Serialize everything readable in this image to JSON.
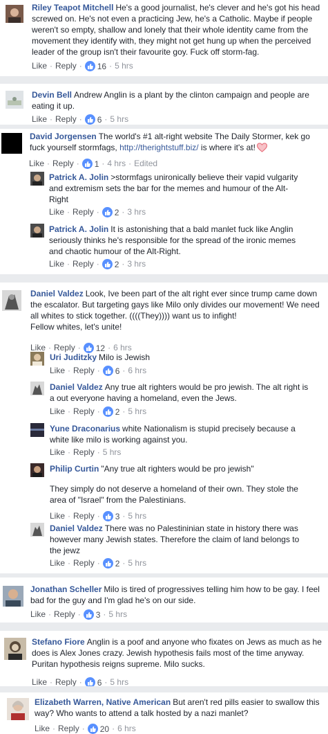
{
  "ui": {
    "like": "Like",
    "reply": "Reply",
    "edited": "Edited",
    "dot": "·"
  },
  "comments": [
    {
      "author": "Riley Teapot Mitchell",
      "text": "He's a good journalist, he's clever and he's got his head screwed on. He's not even a practicing Jew, he's a Catholic. Maybe if people weren't so empty, shallow and lonely that their whole identity came from the movement they identify with, they might not get hung up when the perceived leader of the group isn't their favourite goy. Fuck off storm-fag.",
      "likes": "16",
      "time": "5 hrs"
    },
    {
      "author": "Devin Bell",
      "text": "Andrew Anglin is a plant by the clinton campaign and people are eating it up.",
      "likes": "6",
      "time": "5 hrs"
    },
    {
      "author": "David Jorgensen",
      "text": "The world's #1 alt-right website The Daily Stormer, kek go fuck yourself stormfags,",
      "link": "http://therightstuff.biz/",
      "text_after": "is where it's at!",
      "likes": "1",
      "time": "4 hrs"
    },
    {
      "author": "Patrick A. Jolin",
      "text": ">stormfags unironically believe their vapid vulgarity and extremism sets the bar for the memes and humour of the Alt-Right",
      "likes": "2",
      "time": "3 hrs"
    },
    {
      "author": "Patrick A. Jolin",
      "text": "It is astonishing that a bald manlet fuck like Anglin seriously thinks he's responsible for the spread of the ironic memes and chaotic humour of the Alt-Right.",
      "likes": "2",
      "time": "3 hrs"
    },
    {
      "author": "Daniel Valdez",
      "text": "Look, Ive been part of the alt right ever since trump came down the escalator. But targeting gays like Milo only divides our movement! We need all whites to stick together. ((((They)))) want us to infight!",
      "text2": "Fellow whites, let's unite!",
      "likes": "12",
      "time": "6 hrs"
    },
    {
      "author": "Uri Juditzky",
      "text": "Milo is Jewish",
      "likes": "6",
      "time": "6 hrs"
    },
    {
      "author": "Daniel Valdez",
      "text": "Any true alt righters would be pro jewish. The alt right is a out everyone having a homeland, even the Jews.",
      "likes": "2",
      "time": "5 hrs"
    },
    {
      "author": "Yune Draconarius",
      "text": "white Nationalism is stupid precisely because a white like milo is working against you.",
      "time": "5 hrs"
    },
    {
      "author": "Philip Curtin",
      "text": "\"Any true alt righters would be pro jewish\"",
      "text2": "They simply do not deserve a homeland of their own. They stole the area of \"Israel\" from the Palestinians.",
      "likes": "3",
      "time": "5 hrs"
    },
    {
      "author": "Daniel Valdez",
      "text": "There was no Palestininian state in history there was however many Jewish states. Therefore the claim of land belongs to the jewz",
      "likes": "2",
      "time": "5 hrs"
    },
    {
      "author": "Jonathan Scheller",
      "text": "Milo is tired of progressives telling him how to be gay. I feel bad for the guy and I'm glad he's on our side.",
      "likes": "3",
      "time": "5 hrs"
    },
    {
      "author": "Stefano Fiore",
      "text": "Anglin is a poof and anyone who fixates on Jews as much as he does is Alex Jones crazy. Jewish hypothesis fails most of the time anyway. Puritan hypothesis reigns supreme. Milo sucks.",
      "likes": "6",
      "time": "5 hrs"
    },
    {
      "author": "Elizabeth Warren, Native American",
      "text": "But aren't red pills easier to swallow this way? Who wants to attend a talk hosted by a nazi manlet?",
      "likes": "20",
      "time": "6 hrs"
    }
  ]
}
